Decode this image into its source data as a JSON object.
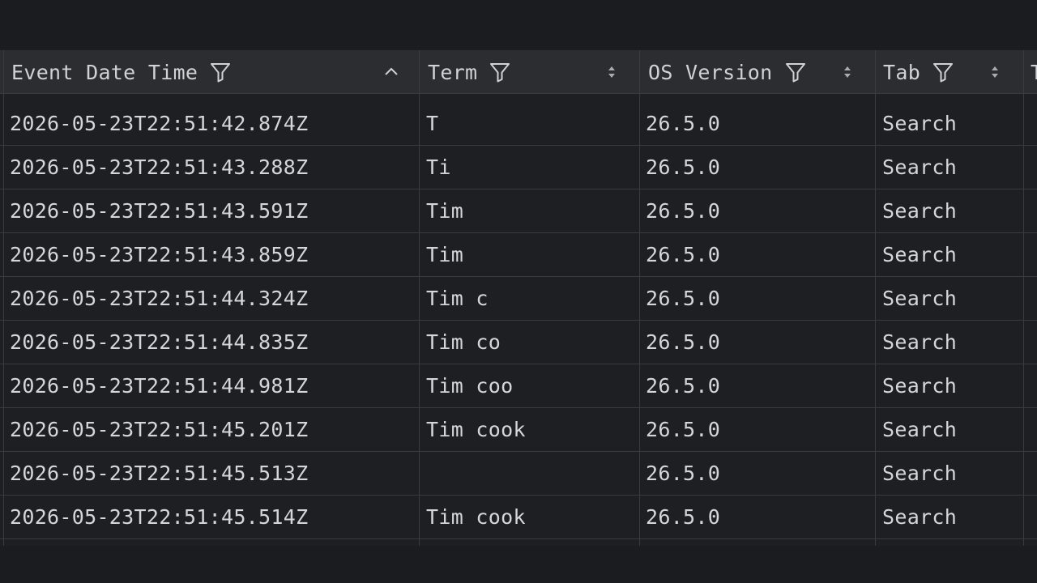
{
  "table": {
    "columns": [
      {
        "label": "Event Date Time",
        "sort": "ascending"
      },
      {
        "label": "Term",
        "sort": "none"
      },
      {
        "label": "OS Version",
        "sort": "none"
      },
      {
        "label": "Tab",
        "sort": "none"
      },
      {
        "label": "T",
        "sort": "none"
      }
    ],
    "rows": [
      {
        "event_date_time": "2026-05-23T22:51:42.874Z",
        "term": "T",
        "os_version": "26.5.0",
        "tab": "Search"
      },
      {
        "event_date_time": "2026-05-23T22:51:43.288Z",
        "term": "Ti",
        "os_version": "26.5.0",
        "tab": "Search"
      },
      {
        "event_date_time": "2026-05-23T22:51:43.591Z",
        "term": "Tim",
        "os_version": "26.5.0",
        "tab": "Search"
      },
      {
        "event_date_time": "2026-05-23T22:51:43.859Z",
        "term": "Tim",
        "os_version": "26.5.0",
        "tab": "Search"
      },
      {
        "event_date_time": "2026-05-23T22:51:44.324Z",
        "term": "Tim c",
        "os_version": "26.5.0",
        "tab": "Search"
      },
      {
        "event_date_time": "2026-05-23T22:51:44.835Z",
        "term": "Tim co",
        "os_version": "26.5.0",
        "tab": "Search"
      },
      {
        "event_date_time": "2026-05-23T22:51:44.981Z",
        "term": "Tim coo",
        "os_version": "26.5.0",
        "tab": "Search"
      },
      {
        "event_date_time": "2026-05-23T22:51:45.201Z",
        "term": "Tim cook",
        "os_version": "26.5.0",
        "tab": "Search"
      },
      {
        "event_date_time": "2026-05-23T22:51:45.513Z",
        "term": "",
        "os_version": "26.5.0",
        "tab": "Search"
      },
      {
        "event_date_time": "2026-05-23T22:51:45.514Z",
        "term": "Tim cook",
        "os_version": "26.5.0",
        "tab": "Search"
      }
    ]
  },
  "icons": {
    "filter": "filter-funnel-icon",
    "sort_ascending": "chevron-up-icon",
    "sort_unsorted": "sort-updown-icon"
  },
  "colors": {
    "background": "#1e1f22",
    "header": "#2b2d30",
    "grid_line": "#393b40",
    "text": "#d4d6da"
  }
}
